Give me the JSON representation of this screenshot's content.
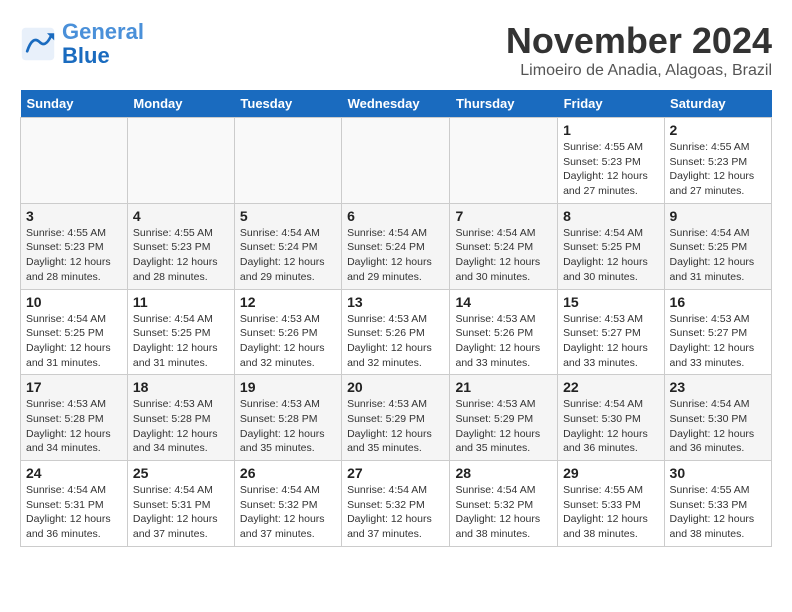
{
  "logo": {
    "text_general": "General",
    "text_blue": "Blue"
  },
  "header": {
    "month": "November 2024",
    "location": "Limoeiro de Anadia, Alagoas, Brazil"
  },
  "weekdays": [
    "Sunday",
    "Monday",
    "Tuesday",
    "Wednesday",
    "Thursday",
    "Friday",
    "Saturday"
  ],
  "weeks": [
    [
      {
        "day": "",
        "info": ""
      },
      {
        "day": "",
        "info": ""
      },
      {
        "day": "",
        "info": ""
      },
      {
        "day": "",
        "info": ""
      },
      {
        "day": "",
        "info": ""
      },
      {
        "day": "1",
        "info": "Sunrise: 4:55 AM\nSunset: 5:23 PM\nDaylight: 12 hours\nand 27 minutes."
      },
      {
        "day": "2",
        "info": "Sunrise: 4:55 AM\nSunset: 5:23 PM\nDaylight: 12 hours\nand 27 minutes."
      }
    ],
    [
      {
        "day": "3",
        "info": "Sunrise: 4:55 AM\nSunset: 5:23 PM\nDaylight: 12 hours\nand 28 minutes."
      },
      {
        "day": "4",
        "info": "Sunrise: 4:55 AM\nSunset: 5:23 PM\nDaylight: 12 hours\nand 28 minutes."
      },
      {
        "day": "5",
        "info": "Sunrise: 4:54 AM\nSunset: 5:24 PM\nDaylight: 12 hours\nand 29 minutes."
      },
      {
        "day": "6",
        "info": "Sunrise: 4:54 AM\nSunset: 5:24 PM\nDaylight: 12 hours\nand 29 minutes."
      },
      {
        "day": "7",
        "info": "Sunrise: 4:54 AM\nSunset: 5:24 PM\nDaylight: 12 hours\nand 30 minutes."
      },
      {
        "day": "8",
        "info": "Sunrise: 4:54 AM\nSunset: 5:25 PM\nDaylight: 12 hours\nand 30 minutes."
      },
      {
        "day": "9",
        "info": "Sunrise: 4:54 AM\nSunset: 5:25 PM\nDaylight: 12 hours\nand 31 minutes."
      }
    ],
    [
      {
        "day": "10",
        "info": "Sunrise: 4:54 AM\nSunset: 5:25 PM\nDaylight: 12 hours\nand 31 minutes."
      },
      {
        "day": "11",
        "info": "Sunrise: 4:54 AM\nSunset: 5:25 PM\nDaylight: 12 hours\nand 31 minutes."
      },
      {
        "day": "12",
        "info": "Sunrise: 4:53 AM\nSunset: 5:26 PM\nDaylight: 12 hours\nand 32 minutes."
      },
      {
        "day": "13",
        "info": "Sunrise: 4:53 AM\nSunset: 5:26 PM\nDaylight: 12 hours\nand 32 minutes."
      },
      {
        "day": "14",
        "info": "Sunrise: 4:53 AM\nSunset: 5:26 PM\nDaylight: 12 hours\nand 33 minutes."
      },
      {
        "day": "15",
        "info": "Sunrise: 4:53 AM\nSunset: 5:27 PM\nDaylight: 12 hours\nand 33 minutes."
      },
      {
        "day": "16",
        "info": "Sunrise: 4:53 AM\nSunset: 5:27 PM\nDaylight: 12 hours\nand 33 minutes."
      }
    ],
    [
      {
        "day": "17",
        "info": "Sunrise: 4:53 AM\nSunset: 5:28 PM\nDaylight: 12 hours\nand 34 minutes."
      },
      {
        "day": "18",
        "info": "Sunrise: 4:53 AM\nSunset: 5:28 PM\nDaylight: 12 hours\nand 34 minutes."
      },
      {
        "day": "19",
        "info": "Sunrise: 4:53 AM\nSunset: 5:28 PM\nDaylight: 12 hours\nand 35 minutes."
      },
      {
        "day": "20",
        "info": "Sunrise: 4:53 AM\nSunset: 5:29 PM\nDaylight: 12 hours\nand 35 minutes."
      },
      {
        "day": "21",
        "info": "Sunrise: 4:53 AM\nSunset: 5:29 PM\nDaylight: 12 hours\nand 35 minutes."
      },
      {
        "day": "22",
        "info": "Sunrise: 4:54 AM\nSunset: 5:30 PM\nDaylight: 12 hours\nand 36 minutes."
      },
      {
        "day": "23",
        "info": "Sunrise: 4:54 AM\nSunset: 5:30 PM\nDaylight: 12 hours\nand 36 minutes."
      }
    ],
    [
      {
        "day": "24",
        "info": "Sunrise: 4:54 AM\nSunset: 5:31 PM\nDaylight: 12 hours\nand 36 minutes."
      },
      {
        "day": "25",
        "info": "Sunrise: 4:54 AM\nSunset: 5:31 PM\nDaylight: 12 hours\nand 37 minutes."
      },
      {
        "day": "26",
        "info": "Sunrise: 4:54 AM\nSunset: 5:32 PM\nDaylight: 12 hours\nand 37 minutes."
      },
      {
        "day": "27",
        "info": "Sunrise: 4:54 AM\nSunset: 5:32 PM\nDaylight: 12 hours\nand 37 minutes."
      },
      {
        "day": "28",
        "info": "Sunrise: 4:54 AM\nSunset: 5:32 PM\nDaylight: 12 hours\nand 38 minutes."
      },
      {
        "day": "29",
        "info": "Sunrise: 4:55 AM\nSunset: 5:33 PM\nDaylight: 12 hours\nand 38 minutes."
      },
      {
        "day": "30",
        "info": "Sunrise: 4:55 AM\nSunset: 5:33 PM\nDaylight: 12 hours\nand 38 minutes."
      }
    ]
  ]
}
